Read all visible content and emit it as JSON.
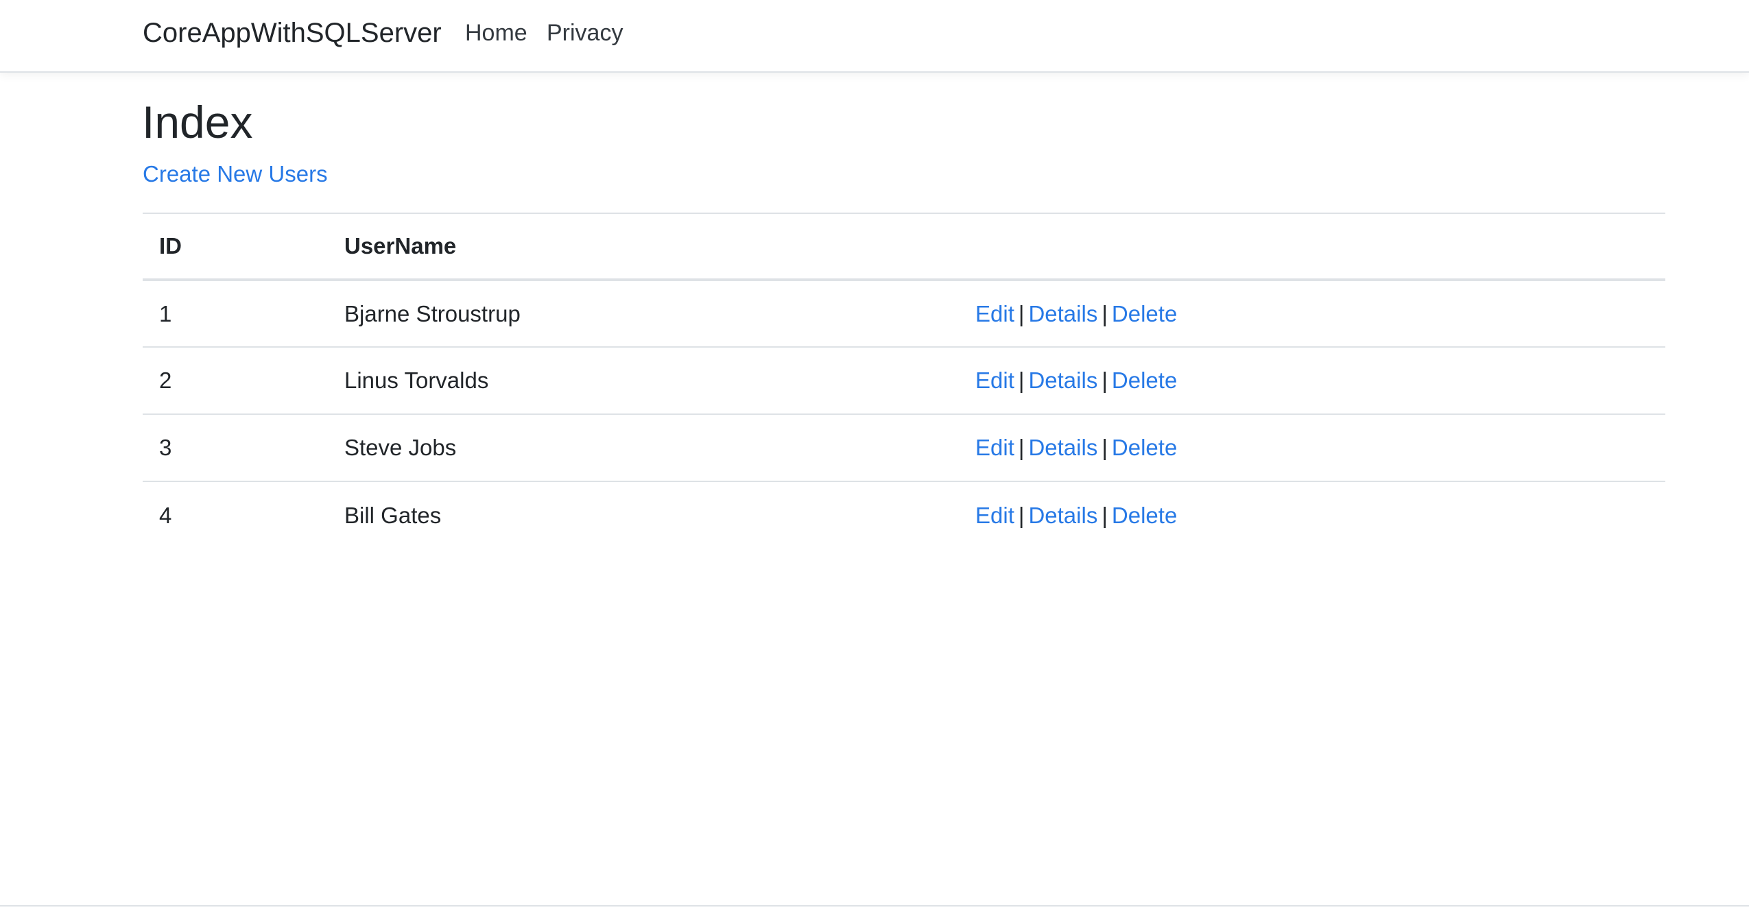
{
  "navbar": {
    "brand": "CoreAppWithSQLServer",
    "links": [
      {
        "label": "Home"
      },
      {
        "label": "Privacy"
      }
    ]
  },
  "main": {
    "title": "Index",
    "create_link": "Create New Users",
    "table": {
      "headers": [
        "ID",
        "UserName",
        ""
      ],
      "rows": [
        {
          "id": "1",
          "username": "Bjarne Stroustrup"
        },
        {
          "id": "2",
          "username": "Linus Torvalds"
        },
        {
          "id": "3",
          "username": "Steve Jobs"
        },
        {
          "id": "4",
          "username": "Bill Gates"
        }
      ],
      "actions": {
        "edit": "Edit",
        "details": "Details",
        "delete": "Delete",
        "separator": "|"
      }
    }
  },
  "colors": {
    "link": "#2779e6",
    "text": "#212529",
    "border": "#dee2e6"
  }
}
